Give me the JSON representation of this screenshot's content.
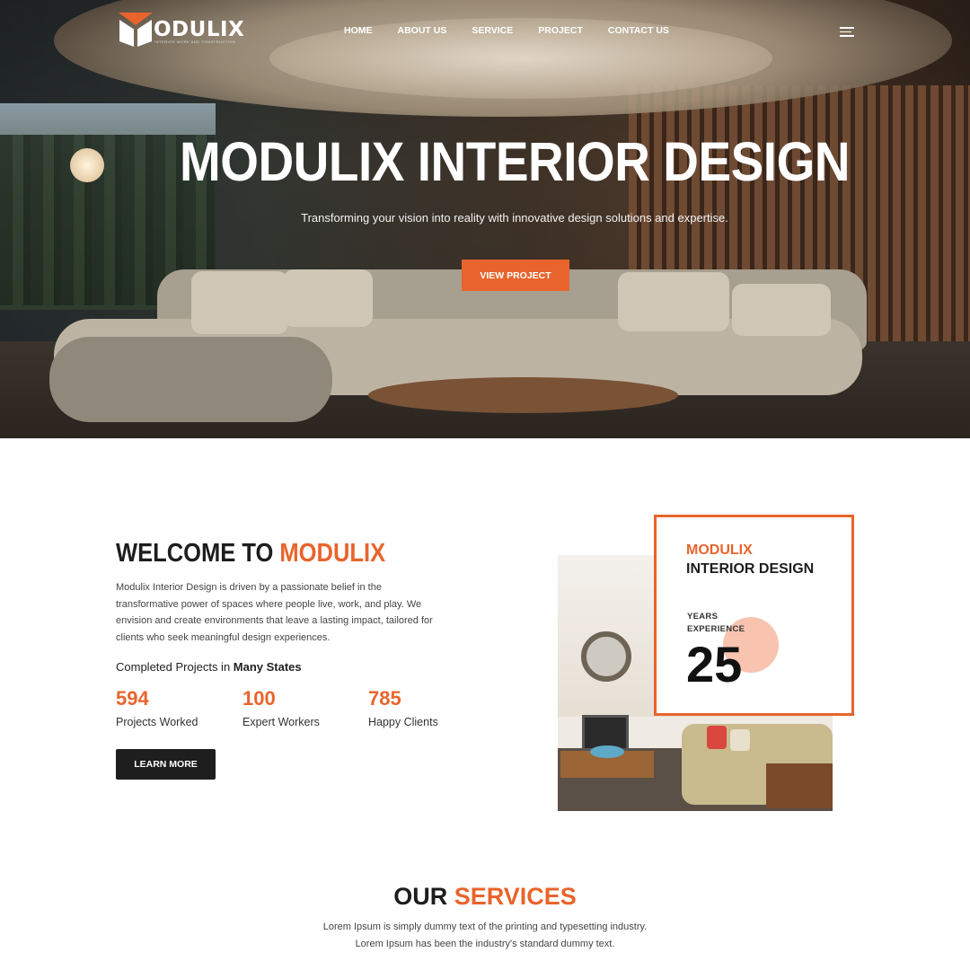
{
  "brand": {
    "name": "ODULIX",
    "tagline": "INTERIOR WORK AND CONSTRUCTION"
  },
  "nav": {
    "items": [
      "HOME",
      "ABOUT US",
      "SERVICE",
      "PROJECT",
      "CONTACT US"
    ]
  },
  "hero": {
    "title": "MODULIX INTERIOR DESIGN",
    "subtitle": "Transforming your vision into reality with innovative design solutions and expertise.",
    "button": "VIEW PROJECT"
  },
  "welcome": {
    "title_prefix": "WELCOME TO ",
    "title_accent": "MODULIX",
    "description": "Modulix Interior Design is driven by a passionate belief in the transformative power of spaces where people live, work, and play. We envision and create environments that leave a lasting impact, tailored for clients who seek meaningful design experiences.",
    "sub_prefix": "Completed Projects in ",
    "sub_bold": "Many States",
    "stats": [
      {
        "number": "594",
        "label": "Projects Worked"
      },
      {
        "number": "100",
        "label": "Expert Workers"
      },
      {
        "number": "785",
        "label": "Happy Clients"
      }
    ],
    "button": "LEARN MORE"
  },
  "experience_card": {
    "brand": "MODULIX",
    "title": "INTERIOR DESIGN",
    "label_line1": "YEARS",
    "label_line2": "EXPERIENCE",
    "years": "25"
  },
  "services": {
    "title_prefix": "OUR ",
    "title_accent": "SERVICES",
    "line1": "Lorem Ipsum is simply dummy text of the printing and typesetting industry.",
    "line2": "Lorem Ipsum has been the industry's standard dummy text."
  },
  "colors": {
    "accent": "#e8642c",
    "dark": "#1e1e1e"
  }
}
